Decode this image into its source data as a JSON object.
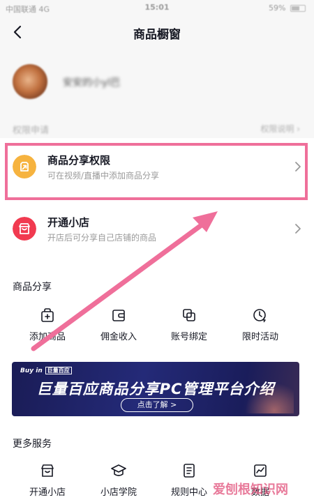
{
  "status_bar": {
    "carrier": "中国联通 4G",
    "time": "15:01",
    "battery": "59%"
  },
  "nav": {
    "title": "商品橱窗"
  },
  "profile": {
    "username": "安安的小yl巴",
    "apply_label": "权限申请",
    "apply_right": "权限说明"
  },
  "rows": [
    {
      "label": "商品分享权限",
      "sub": "可在视频/直播中添加商品分享",
      "icon": "share-arrow-icon",
      "color": "#f6b33f"
    },
    {
      "label": "开通小店",
      "sub": "开店后可分享自己店铺的商品",
      "icon": "shop-icon",
      "color": "#f13a50"
    }
  ],
  "goods_share": {
    "title": "商品分享",
    "items": [
      {
        "label": "添加商品",
        "icon": "add-bag-icon"
      },
      {
        "label": "佣金收入",
        "icon": "wallet-icon"
      },
      {
        "label": "账号绑定",
        "icon": "link-icon"
      },
      {
        "label": "限时活动",
        "icon": "timer-icon"
      }
    ]
  },
  "banner": {
    "tag": "Buy in",
    "tag2": "巨量百应",
    "headline": "巨量百应商品分享PC管理平台介绍",
    "cta": "点击了解 >"
  },
  "more_services": {
    "title": "更多服务",
    "items": [
      {
        "label": "开通小店",
        "icon": "shop-icon"
      },
      {
        "label": "小店学院",
        "icon": "graduation-cap-icon"
      },
      {
        "label": "规则中心",
        "icon": "document-icon"
      },
      {
        "label": "数据",
        "icon": "chart-icon"
      }
    ]
  },
  "watermark": "爱刨根知识网",
  "colors": {
    "highlight": "#ef6f9a",
    "arrow": "#ef6f9a",
    "share_icon": "#f6b33f",
    "shop_icon": "#f13a50"
  }
}
